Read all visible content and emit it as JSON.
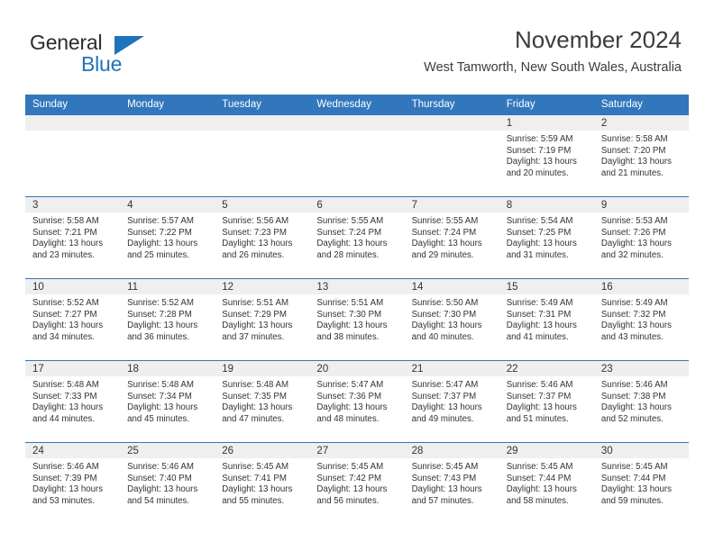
{
  "brand": {
    "name_part1": "General",
    "name_part2": "Blue",
    "flag_icon": "triangle-flag-icon"
  },
  "header": {
    "title": "November 2024",
    "location": "West Tamworth, New South Wales, Australia"
  },
  "colors": {
    "header_blue": "#3277bc",
    "brand_blue": "#1f73bd",
    "daynum_bg": "#efefef",
    "text": "#333333"
  },
  "weekday_headers": [
    "Sunday",
    "Monday",
    "Tuesday",
    "Wednesday",
    "Thursday",
    "Friday",
    "Saturday"
  ],
  "labels": {
    "sunrise_prefix": "Sunrise:",
    "sunset_prefix": "Sunset:",
    "daylight_prefix": "Daylight:"
  },
  "weeks": [
    [
      {
        "day": "",
        "empty": true
      },
      {
        "day": "",
        "empty": true
      },
      {
        "day": "",
        "empty": true
      },
      {
        "day": "",
        "empty": true
      },
      {
        "day": "",
        "empty": true
      },
      {
        "day": "1",
        "sunrise": "Sunrise: 5:59 AM",
        "sunset": "Sunset: 7:19 PM",
        "daylight_line1": "Daylight: 13 hours",
        "daylight_line2": "and 20 minutes."
      },
      {
        "day": "2",
        "sunrise": "Sunrise: 5:58 AM",
        "sunset": "Sunset: 7:20 PM",
        "daylight_line1": "Daylight: 13 hours",
        "daylight_line2": "and 21 minutes."
      }
    ],
    [
      {
        "day": "3",
        "sunrise": "Sunrise: 5:58 AM",
        "sunset": "Sunset: 7:21 PM",
        "daylight_line1": "Daylight: 13 hours",
        "daylight_line2": "and 23 minutes."
      },
      {
        "day": "4",
        "sunrise": "Sunrise: 5:57 AM",
        "sunset": "Sunset: 7:22 PM",
        "daylight_line1": "Daylight: 13 hours",
        "daylight_line2": "and 25 minutes."
      },
      {
        "day": "5",
        "sunrise": "Sunrise: 5:56 AM",
        "sunset": "Sunset: 7:23 PM",
        "daylight_line1": "Daylight: 13 hours",
        "daylight_line2": "and 26 minutes."
      },
      {
        "day": "6",
        "sunrise": "Sunrise: 5:55 AM",
        "sunset": "Sunset: 7:24 PM",
        "daylight_line1": "Daylight: 13 hours",
        "daylight_line2": "and 28 minutes."
      },
      {
        "day": "7",
        "sunrise": "Sunrise: 5:55 AM",
        "sunset": "Sunset: 7:24 PM",
        "daylight_line1": "Daylight: 13 hours",
        "daylight_line2": "and 29 minutes."
      },
      {
        "day": "8",
        "sunrise": "Sunrise: 5:54 AM",
        "sunset": "Sunset: 7:25 PM",
        "daylight_line1": "Daylight: 13 hours",
        "daylight_line2": "and 31 minutes."
      },
      {
        "day": "9",
        "sunrise": "Sunrise: 5:53 AM",
        "sunset": "Sunset: 7:26 PM",
        "daylight_line1": "Daylight: 13 hours",
        "daylight_line2": "and 32 minutes."
      }
    ],
    [
      {
        "day": "10",
        "sunrise": "Sunrise: 5:52 AM",
        "sunset": "Sunset: 7:27 PM",
        "daylight_line1": "Daylight: 13 hours",
        "daylight_line2": "and 34 minutes."
      },
      {
        "day": "11",
        "sunrise": "Sunrise: 5:52 AM",
        "sunset": "Sunset: 7:28 PM",
        "daylight_line1": "Daylight: 13 hours",
        "daylight_line2": "and 36 minutes."
      },
      {
        "day": "12",
        "sunrise": "Sunrise: 5:51 AM",
        "sunset": "Sunset: 7:29 PM",
        "daylight_line1": "Daylight: 13 hours",
        "daylight_line2": "and 37 minutes."
      },
      {
        "day": "13",
        "sunrise": "Sunrise: 5:51 AM",
        "sunset": "Sunset: 7:30 PM",
        "daylight_line1": "Daylight: 13 hours",
        "daylight_line2": "and 38 minutes."
      },
      {
        "day": "14",
        "sunrise": "Sunrise: 5:50 AM",
        "sunset": "Sunset: 7:30 PM",
        "daylight_line1": "Daylight: 13 hours",
        "daylight_line2": "and 40 minutes."
      },
      {
        "day": "15",
        "sunrise": "Sunrise: 5:49 AM",
        "sunset": "Sunset: 7:31 PM",
        "daylight_line1": "Daylight: 13 hours",
        "daylight_line2": "and 41 minutes."
      },
      {
        "day": "16",
        "sunrise": "Sunrise: 5:49 AM",
        "sunset": "Sunset: 7:32 PM",
        "daylight_line1": "Daylight: 13 hours",
        "daylight_line2": "and 43 minutes."
      }
    ],
    [
      {
        "day": "17",
        "sunrise": "Sunrise: 5:48 AM",
        "sunset": "Sunset: 7:33 PM",
        "daylight_line1": "Daylight: 13 hours",
        "daylight_line2": "and 44 minutes."
      },
      {
        "day": "18",
        "sunrise": "Sunrise: 5:48 AM",
        "sunset": "Sunset: 7:34 PM",
        "daylight_line1": "Daylight: 13 hours",
        "daylight_line2": "and 45 minutes."
      },
      {
        "day": "19",
        "sunrise": "Sunrise: 5:48 AM",
        "sunset": "Sunset: 7:35 PM",
        "daylight_line1": "Daylight: 13 hours",
        "daylight_line2": "and 47 minutes."
      },
      {
        "day": "20",
        "sunrise": "Sunrise: 5:47 AM",
        "sunset": "Sunset: 7:36 PM",
        "daylight_line1": "Daylight: 13 hours",
        "daylight_line2": "and 48 minutes."
      },
      {
        "day": "21",
        "sunrise": "Sunrise: 5:47 AM",
        "sunset": "Sunset: 7:37 PM",
        "daylight_line1": "Daylight: 13 hours",
        "daylight_line2": "and 49 minutes."
      },
      {
        "day": "22",
        "sunrise": "Sunrise: 5:46 AM",
        "sunset": "Sunset: 7:37 PM",
        "daylight_line1": "Daylight: 13 hours",
        "daylight_line2": "and 51 minutes."
      },
      {
        "day": "23",
        "sunrise": "Sunrise: 5:46 AM",
        "sunset": "Sunset: 7:38 PM",
        "daylight_line1": "Daylight: 13 hours",
        "daylight_line2": "and 52 minutes."
      }
    ],
    [
      {
        "day": "24",
        "sunrise": "Sunrise: 5:46 AM",
        "sunset": "Sunset: 7:39 PM",
        "daylight_line1": "Daylight: 13 hours",
        "daylight_line2": "and 53 minutes."
      },
      {
        "day": "25",
        "sunrise": "Sunrise: 5:46 AM",
        "sunset": "Sunset: 7:40 PM",
        "daylight_line1": "Daylight: 13 hours",
        "daylight_line2": "and 54 minutes."
      },
      {
        "day": "26",
        "sunrise": "Sunrise: 5:45 AM",
        "sunset": "Sunset: 7:41 PM",
        "daylight_line1": "Daylight: 13 hours",
        "daylight_line2": "and 55 minutes."
      },
      {
        "day": "27",
        "sunrise": "Sunrise: 5:45 AM",
        "sunset": "Sunset: 7:42 PM",
        "daylight_line1": "Daylight: 13 hours",
        "daylight_line2": "and 56 minutes."
      },
      {
        "day": "28",
        "sunrise": "Sunrise: 5:45 AM",
        "sunset": "Sunset: 7:43 PM",
        "daylight_line1": "Daylight: 13 hours",
        "daylight_line2": "and 57 minutes."
      },
      {
        "day": "29",
        "sunrise": "Sunrise: 5:45 AM",
        "sunset": "Sunset: 7:44 PM",
        "daylight_line1": "Daylight: 13 hours",
        "daylight_line2": "and 58 minutes."
      },
      {
        "day": "30",
        "sunrise": "Sunrise: 5:45 AM",
        "sunset": "Sunset: 7:44 PM",
        "daylight_line1": "Daylight: 13 hours",
        "daylight_line2": "and 59 minutes."
      }
    ]
  ]
}
